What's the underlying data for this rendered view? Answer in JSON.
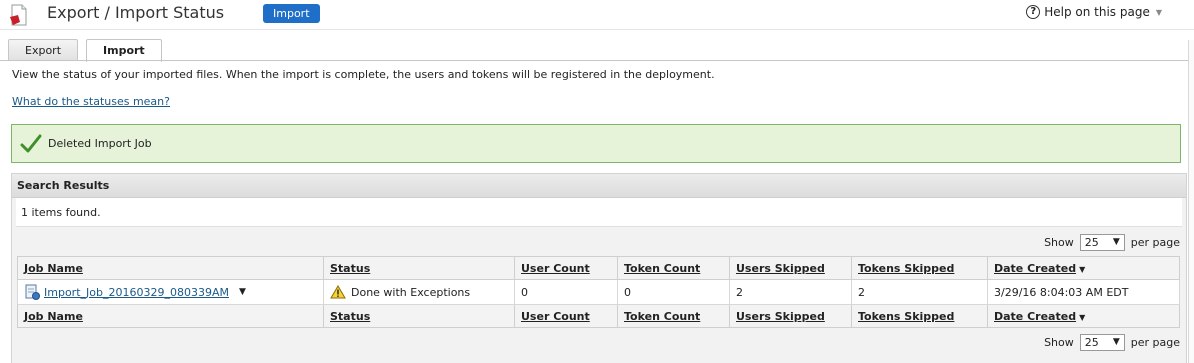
{
  "header": {
    "title": "Export / Import Status",
    "mode_badge": "Import",
    "help_label": "Help on this page"
  },
  "tabs": [
    {
      "label": "Export",
      "active": false
    },
    {
      "label": "Import",
      "active": true
    }
  ],
  "description": "View the status of your imported files. When the import is complete, the users and tokens will be registered in the deployment.",
  "status_help_link": "What do the statuses mean?",
  "message": {
    "text": "Deleted Import Job",
    "type": "success"
  },
  "results": {
    "heading": "Search Results",
    "found_text": "1 items found.",
    "show_label": "Show",
    "per_page_value": "25",
    "per_page_label": "per page",
    "columns": [
      "Job Name",
      "Status",
      "User Count",
      "Token Count",
      "Users Skipped",
      "Tokens Skipped",
      "Date Created"
    ],
    "sort_column": "Date Created",
    "rows": [
      {
        "job_name": "Import_Job_20160329_080339AM",
        "status": "Done with Exceptions",
        "user_count": "0",
        "token_count": "0",
        "users_skipped": "2",
        "tokens_skipped": "2",
        "date_created": "3/29/16 8:04:03 AM EDT"
      }
    ]
  },
  "colors": {
    "accent": "#1f6fc8",
    "success_bg": "#e6f3d9",
    "success_border": "#7fb56a",
    "link": "#1a5a8a"
  },
  "icons": {
    "app": "document-icon",
    "help": "help-circle-icon",
    "success": "checkmark-icon",
    "job": "import-job-icon",
    "status": "warning-icon"
  }
}
